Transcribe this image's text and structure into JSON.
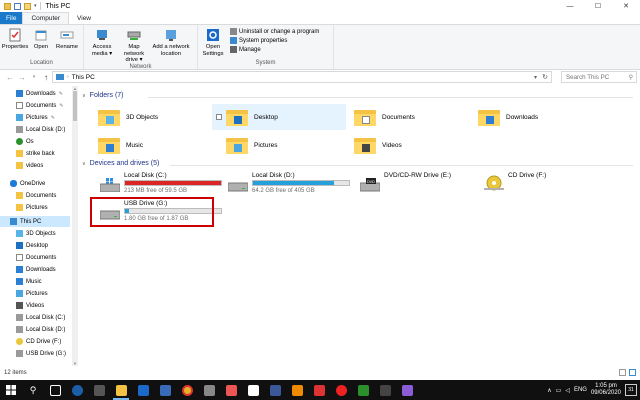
{
  "window": {
    "title": "This PC",
    "controls": {
      "minimize": "—",
      "maximize": "☐",
      "close": "✕"
    }
  },
  "ribbon_tabs": [
    {
      "label": "File"
    },
    {
      "label": "Computer"
    },
    {
      "label": "View"
    }
  ],
  "ribbon": {
    "location": {
      "label": "Location",
      "buttons": [
        {
          "label": "Properties"
        },
        {
          "label": "Open"
        },
        {
          "label": "Rename"
        }
      ]
    },
    "network": {
      "label": "Network",
      "buttons": [
        {
          "label": "Access media ▾"
        },
        {
          "label": "Map network drive ▾"
        },
        {
          "label": "Add a network location"
        }
      ]
    },
    "system": {
      "label": "System",
      "open_settings": "Open Settings",
      "items": [
        {
          "label": "Uninstall or change a program"
        },
        {
          "label": "System properties"
        },
        {
          "label": "Manage"
        }
      ]
    }
  },
  "address": {
    "path": "This PC",
    "search_placeholder": "Search This PC"
  },
  "nav_pane": {
    "items": [
      {
        "label": "Downloads",
        "pinned": true
      },
      {
        "label": "Documents",
        "pinned": true
      },
      {
        "label": "Pictures",
        "pinned": true
      },
      {
        "label": "Local Disk (D:)"
      },
      {
        "label": "Os"
      },
      {
        "label": "strike back"
      },
      {
        "label": "videos"
      },
      {
        "label": "OneDrive"
      },
      {
        "label": "Documents"
      },
      {
        "label": "Pictures"
      },
      {
        "label": "This PC"
      },
      {
        "label": "3D Objects"
      },
      {
        "label": "Desktop"
      },
      {
        "label": "Documents"
      },
      {
        "label": "Downloads"
      },
      {
        "label": "Music"
      },
      {
        "label": "Pictures"
      },
      {
        "label": "Videos"
      },
      {
        "label": "Local Disk (C:)"
      },
      {
        "label": "Local Disk (D:)"
      },
      {
        "label": "CD Drive (F:)"
      },
      {
        "label": "USB Drive (G:)"
      }
    ]
  },
  "folders_section": {
    "header": "Folders (7)",
    "items": [
      {
        "label": "3D Objects"
      },
      {
        "label": "Desktop"
      },
      {
        "label": "Documents"
      },
      {
        "label": "Downloads"
      },
      {
        "label": "Music"
      },
      {
        "label": "Pictures"
      },
      {
        "label": "Videos"
      }
    ]
  },
  "devices_section": {
    "header": "Devices and drives (5)",
    "drives": [
      {
        "label": "Local Disk (C:)",
        "free": "213 MB free of 59.5 GB",
        "used_fraction": 0.997,
        "bar_color": "#da2626"
      },
      {
        "label": "Local Disk (D:)",
        "free": "64.2 GB free of 405 GB",
        "used_fraction": 0.84,
        "bar_color": "#26a0da"
      },
      {
        "label": "DVD/CD-RW Drive (E:)"
      },
      {
        "label": "CD Drive (F:)"
      },
      {
        "label": "USB Drive (G:)",
        "free": "1.80 GB free of 1.87 GB",
        "used_fraction": 0.04,
        "bar_color": "#26a0da"
      }
    ]
  },
  "status": {
    "item_count": "12 items"
  },
  "taskbar": {
    "language": "ENG",
    "time": "1:05 pm",
    "date": "09/06/2020",
    "notification_count": "31"
  }
}
